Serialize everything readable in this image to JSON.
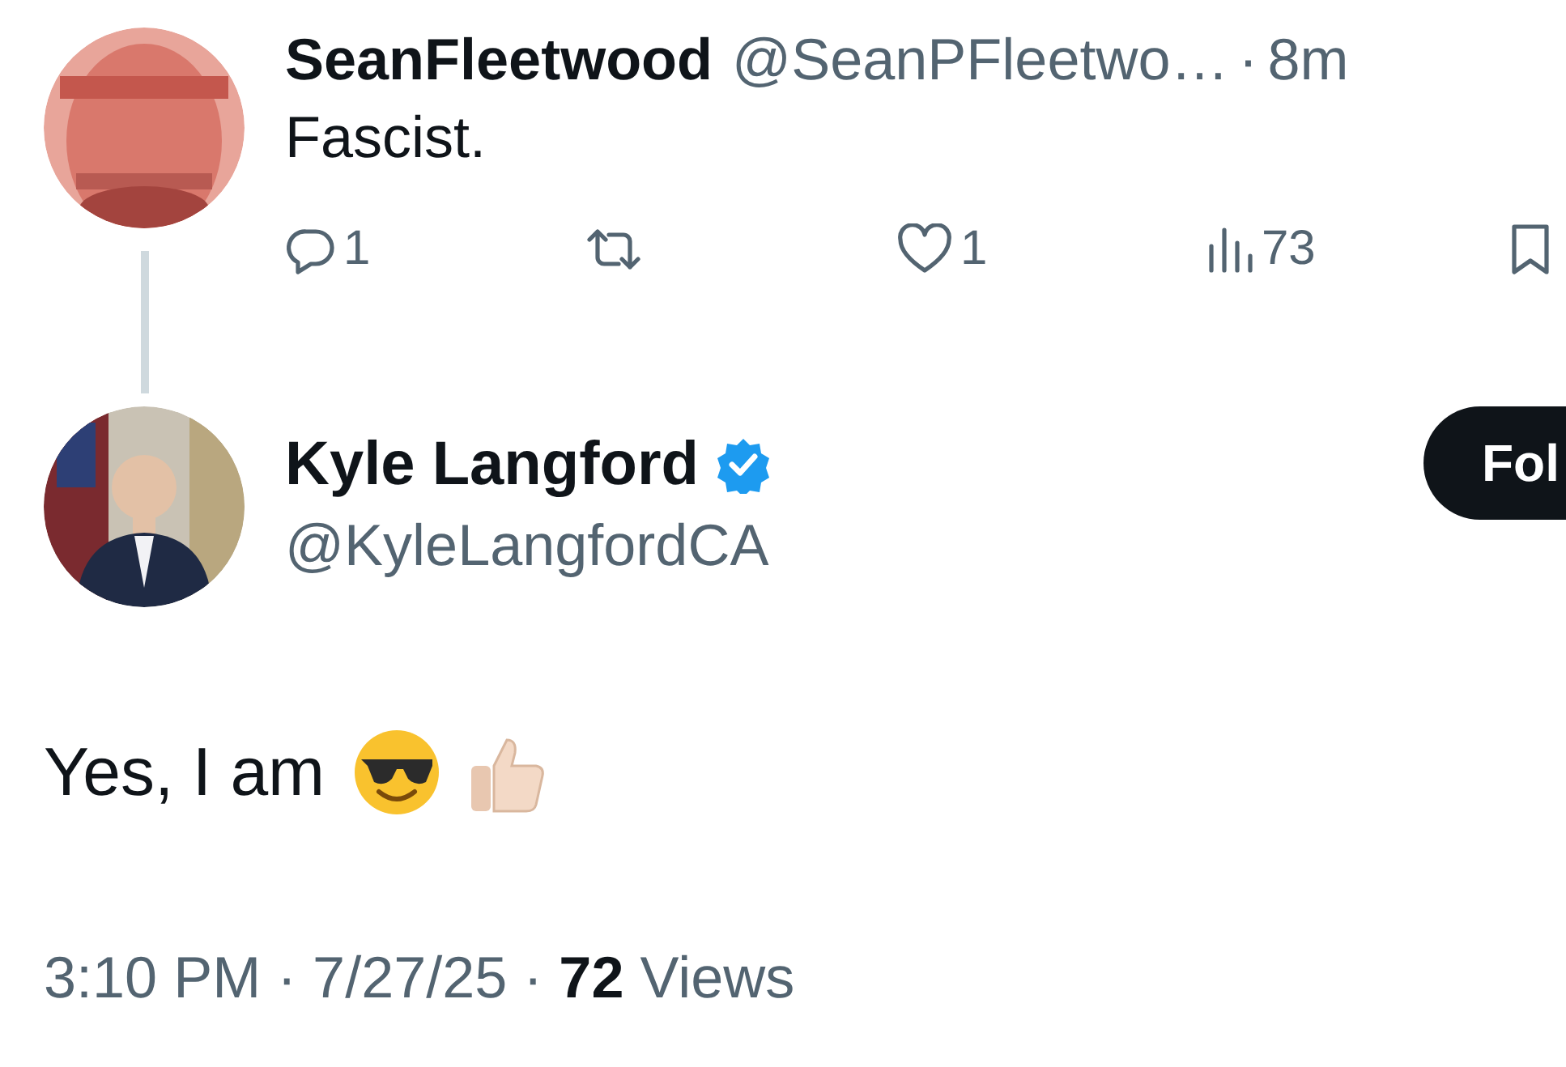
{
  "reply": {
    "name": "SeanFleetwood",
    "handle": "@SeanPFleetwo…",
    "separator": "·",
    "time": "8m",
    "text": "Fascist.",
    "actions": [
      {
        "kind": "reply",
        "count": "1"
      },
      {
        "kind": "repost"
      },
      {
        "kind": "like",
        "count": "1"
      },
      {
        "kind": "views",
        "count": "73"
      },
      {
        "kind": "bookmark"
      }
    ]
  },
  "tweet": {
    "name": "Kyle Langford",
    "verified": true,
    "handle": "@KyleLangfordCA",
    "follow_button": "Fol",
    "text": "Yes, I am",
    "emojis": [
      {
        "kind": "sunglasses"
      },
      {
        "kind": "thumbs_up"
      }
    ],
    "meta": "3:10 PM · 7/27/25 · **72** Views"
  }
}
